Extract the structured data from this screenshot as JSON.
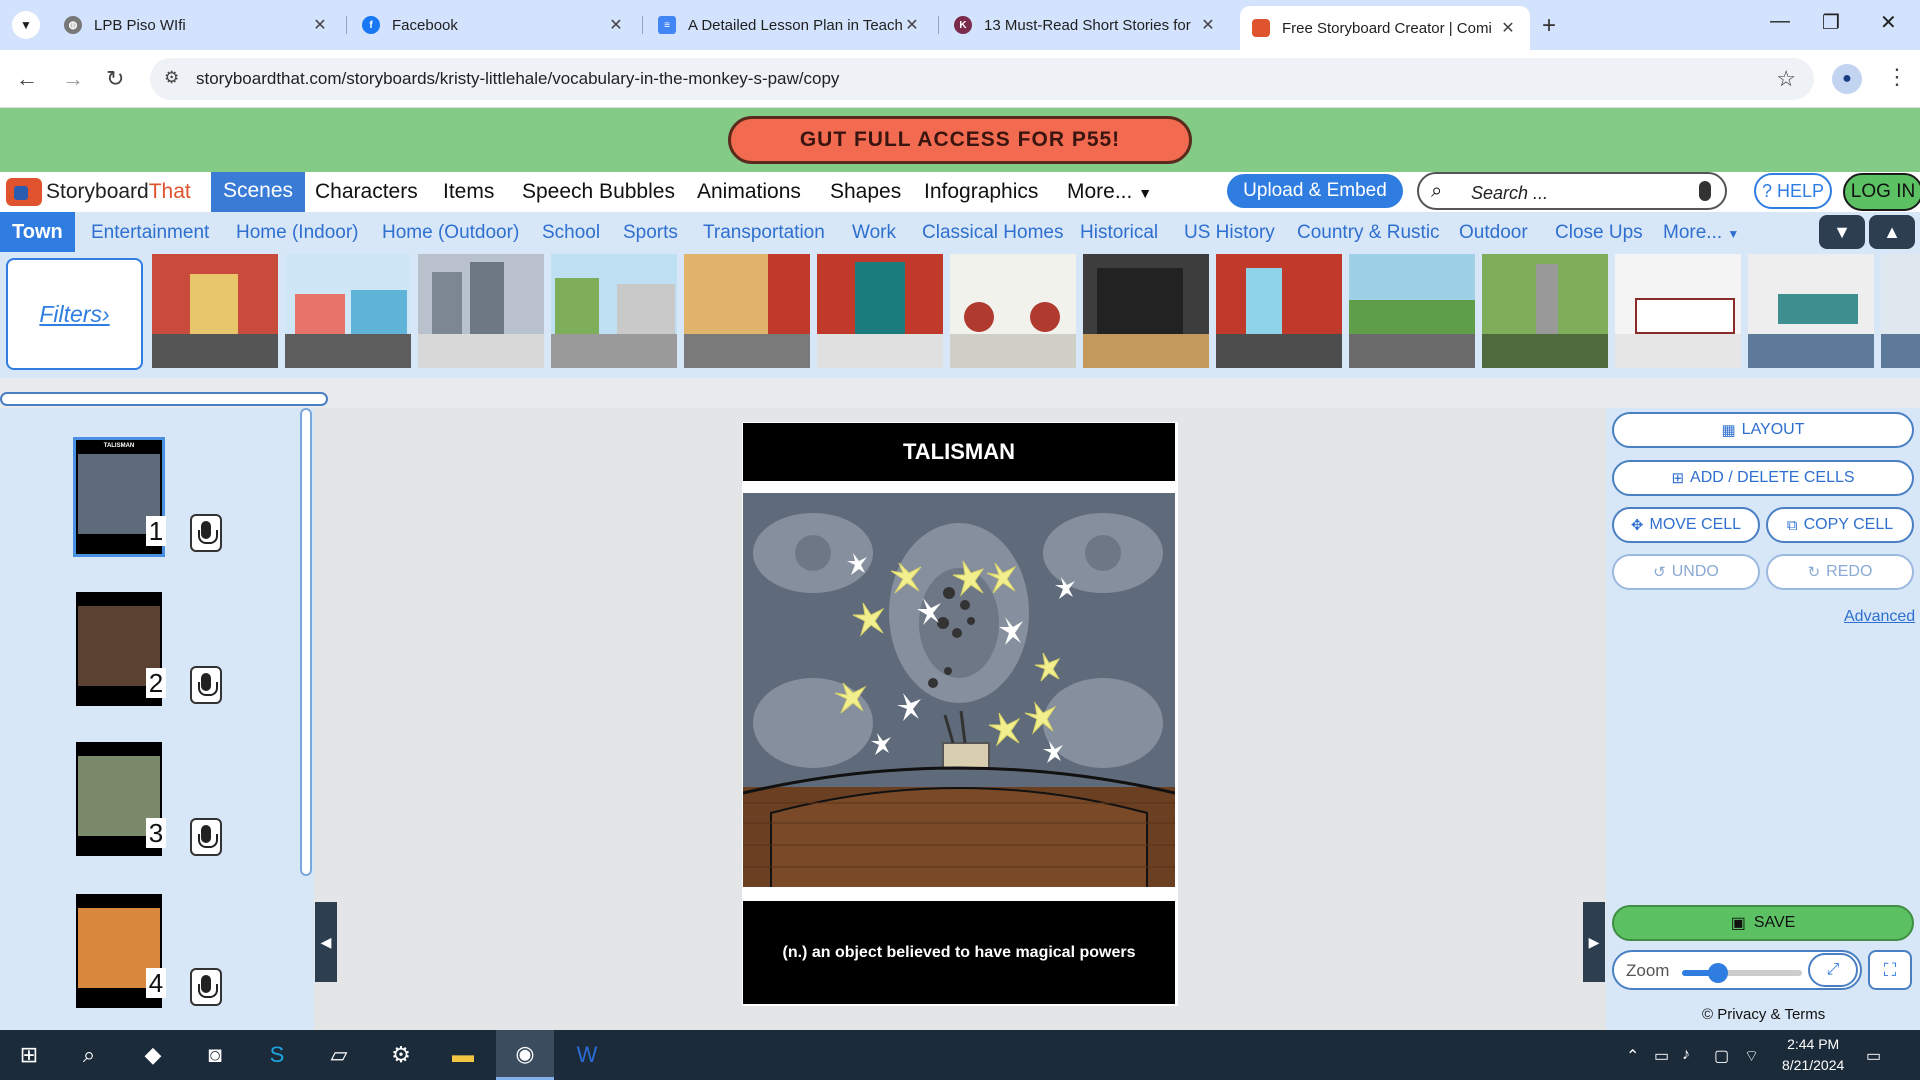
{
  "browser": {
    "tabs": [
      {
        "title": "LPB Piso WIfi",
        "active": false
      },
      {
        "title": "Facebook",
        "active": false
      },
      {
        "title": "A Detailed Lesson Plan in Teach",
        "active": false
      },
      {
        "title": "13 Must-Read Short Stories for",
        "active": false
      },
      {
        "title": "Free Storyboard Creator | Comi",
        "active": true
      }
    ],
    "url": "storyboardthat.com/storyboards/kristy-littlehale/vocabulary-in-the-monkey-s-paw/copy"
  },
  "promo": {
    "label": "GUT FULL ACCESS FOR P55!"
  },
  "site": {
    "logo_part1": "Storyboard",
    "logo_part2": "That",
    "nav": [
      "Scenes",
      "Characters",
      "Items",
      "Speech Bubbles",
      "Animations",
      "Shapes",
      "Infographics",
      "More..."
    ],
    "upload_label": "Upload & Embed",
    "search_placeholder": "Search ...",
    "help_label": "? HELP",
    "login_label": "LOG IN"
  },
  "categories": [
    "Town",
    "Entertainment",
    "Home (Indoor)",
    "Home (Outdoor)",
    "School",
    "Sports",
    "Transportation",
    "Work",
    "Classical Homes",
    "Historical",
    "US History",
    "Country & Rustic",
    "Outdoor",
    "Close Ups",
    "More..."
  ],
  "filters_label": "Filters›",
  "cells": [
    {
      "number": "1",
      "title": "TALISMAN",
      "caption": "(n.) an object believed to have magical powers"
    },
    {
      "number": "2",
      "title": "",
      "caption": ""
    },
    {
      "number": "3",
      "title": "",
      "caption": ""
    },
    {
      "number": "4",
      "title": "",
      "caption": ""
    }
  ],
  "current_cell": {
    "title": "TALISMAN",
    "caption": "(n.) an object believed to have magical powers"
  },
  "right_panel": {
    "layout": "LAYOUT",
    "add_delete": "ADD / DELETE CELLS",
    "move": "MOVE CELL",
    "copy": "COPY CELL",
    "undo": "UNDO",
    "redo": "REDO",
    "advanced": "Advanced",
    "save": "SAVE",
    "zoom_label": "Zoom",
    "zoom_level": 0.3,
    "privacy": "© Privacy & Terms"
  },
  "taskbar": {
    "time": "2:44 PM",
    "date": "8/21/2024"
  }
}
